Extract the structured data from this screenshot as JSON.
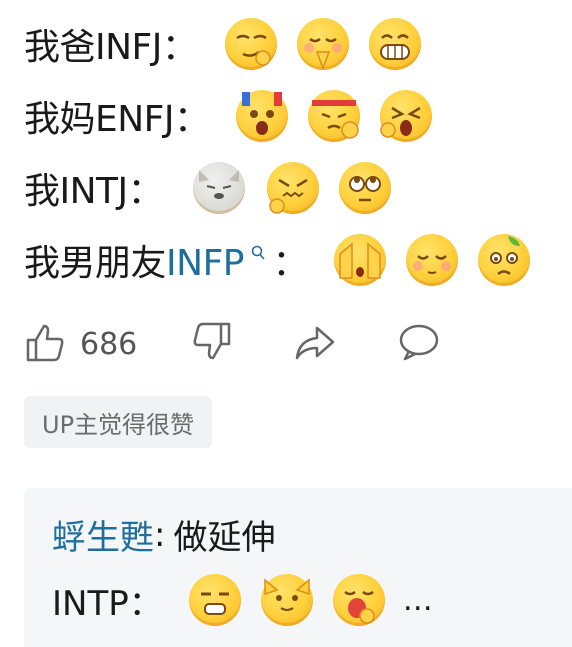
{
  "lines": [
    {
      "text": "我爸INFJ："
    },
    {
      "text": "我妈ENFJ："
    },
    {
      "text": "我INTJ："
    },
    {
      "text_prefix": "我男朋友",
      "text_link": "INFP",
      "text_suffix": "："
    }
  ],
  "actions": {
    "like_count": "686"
  },
  "badge": "UP主觉得很赞",
  "reply": {
    "author": "蜉生甦",
    "separator": ":",
    "text": "做延伸",
    "line2": "INTP：",
    "ellipsis": "…"
  },
  "icons": [
    "thumbs-up-icon",
    "thumbs-down-icon",
    "share-icon",
    "comment-icon",
    "search-icon"
  ],
  "colors": {
    "link": "#1f6f9e",
    "badge_bg": "#f1f2f4",
    "reply_bg": "#f5f6f7"
  }
}
